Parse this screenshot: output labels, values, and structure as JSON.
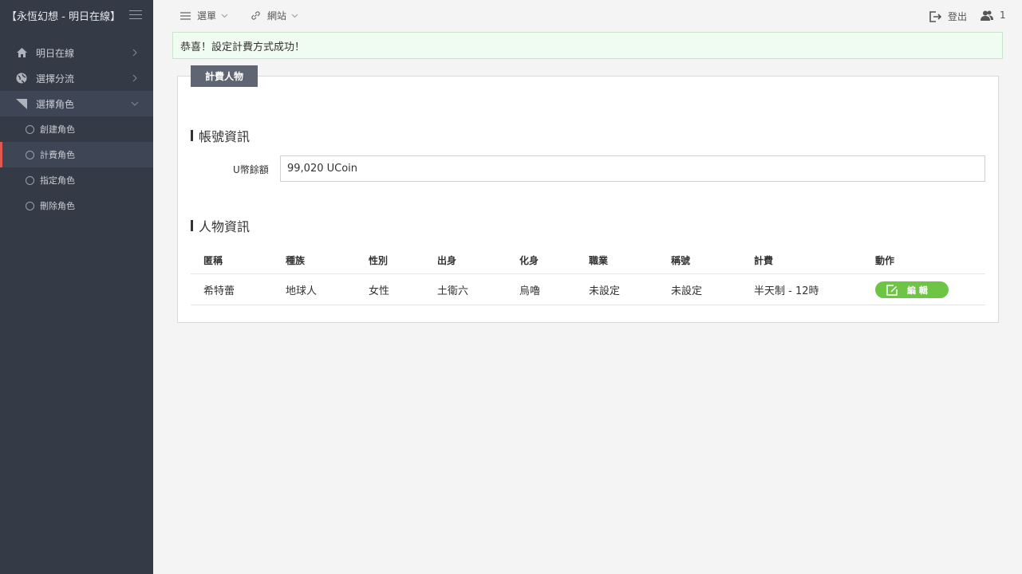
{
  "brand": {
    "title": "【永恆幻想 - 明日在線】"
  },
  "sidebar": {
    "items": [
      {
        "label": "明日在線"
      },
      {
        "label": "選擇分流"
      },
      {
        "label": "選擇角色"
      }
    ],
    "subitems": [
      {
        "label": "創建角色"
      },
      {
        "label": "計費角色"
      },
      {
        "label": "指定角色"
      },
      {
        "label": "刪除角色"
      }
    ]
  },
  "topbar": {
    "menu_label": "選單",
    "site_label": "網站",
    "logout_label": "登出",
    "users_count": "1"
  },
  "alert": {
    "text": "恭喜！設定計費方式成功！"
  },
  "panel": {
    "tab_label": "計費人物",
    "account_section": "帳號資訊",
    "ucoin_label": "U幣餘額",
    "ucoin_value": "99,020 UCoin",
    "character_section": "人物資訊"
  },
  "table": {
    "headers": [
      "匿稱",
      "種族",
      "性別",
      "出身",
      "化身",
      "職業",
      "稱號",
      "計費",
      "動作"
    ],
    "rows": [
      [
        "希特蕾",
        "地球人",
        "女性",
        "土衛六",
        "烏嚕",
        "未設定",
        "未設定",
        "半天制 - 12時"
      ]
    ],
    "edit_label": "編 輯"
  },
  "colors": {
    "sidebar_bg": "#343a46",
    "active_accent": "#e4574e",
    "edit_button": "#6ec444",
    "alert_bg": "#f0fbf1",
    "tab_bg": "#5f6573"
  }
}
